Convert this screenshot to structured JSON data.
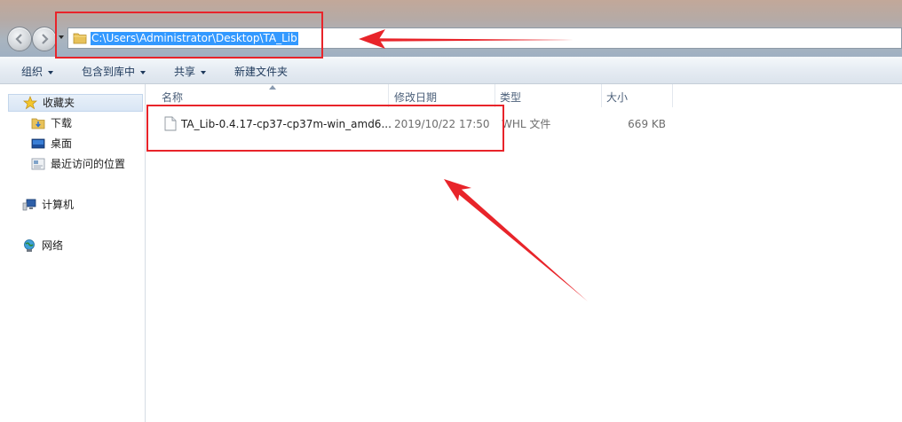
{
  "address": {
    "path": "C:\\Users\\Administrator\\Desktop\\TA_Lib",
    "folder_icon": "folder-icon"
  },
  "toolbar": {
    "organize": "组织",
    "include_in_library": "包含到库中",
    "share": "共享",
    "new_folder": "新建文件夹"
  },
  "sidebar": {
    "favorites": "收藏夹",
    "downloads": "下载",
    "desktop": "桌面",
    "recent": "最近访问的位置",
    "computer": "计算机",
    "network": "网络"
  },
  "columns": {
    "name": "名称",
    "date": "修改日期",
    "type": "类型",
    "size": "大小"
  },
  "files": [
    {
      "name": "TA_Lib-0.4.17-cp37-cp37m-win_amd6...",
      "date": "2019/10/22 17:50",
      "type": "WHL 文件",
      "size": "669 KB",
      "icon": "file-icon"
    }
  ],
  "annotations": {
    "color": "#e8242a",
    "items": [
      "address-box",
      "file-box",
      "address-arrow",
      "file-arrow"
    ]
  }
}
